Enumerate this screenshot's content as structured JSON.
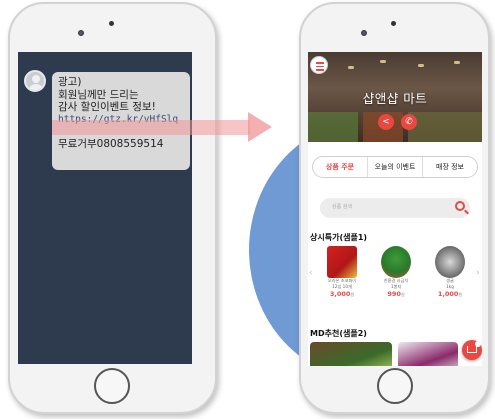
{
  "sms": {
    "lines": [
      "광고)",
      "회원님께만 드리는",
      "감사 할인이벤트 정보!"
    ],
    "link": "https://gtz.kr/vHfSlq",
    "optout": "무료거부0808559514"
  },
  "app": {
    "store_title": "샵앤샵 마트",
    "tabs": [
      {
        "label": "상품 주문",
        "active": true
      },
      {
        "label": "오늘의 이벤트",
        "active": false
      },
      {
        "label": "매장 정보",
        "active": false
      }
    ],
    "search_placeholder": "상품 검색",
    "section_special": "상시특가(샘플1)",
    "section_md": "MD추천(샘플2)",
    "products": [
      {
        "name1": "오리온 초코파이",
        "name2": "12입 10개",
        "price": "3,000",
        "won": "원"
      },
      {
        "name1": "친환경 시금치",
        "name2": "1봉지",
        "price": "990",
        "won": "원"
      },
      {
        "name1": "생굴",
        "name2": "1kg",
        "price": "1,000",
        "won": "원"
      }
    ]
  },
  "colors": {
    "accent": "#e8483f",
    "sms_screen": "#2e3a4e",
    "circle": "#6f9ad4"
  }
}
